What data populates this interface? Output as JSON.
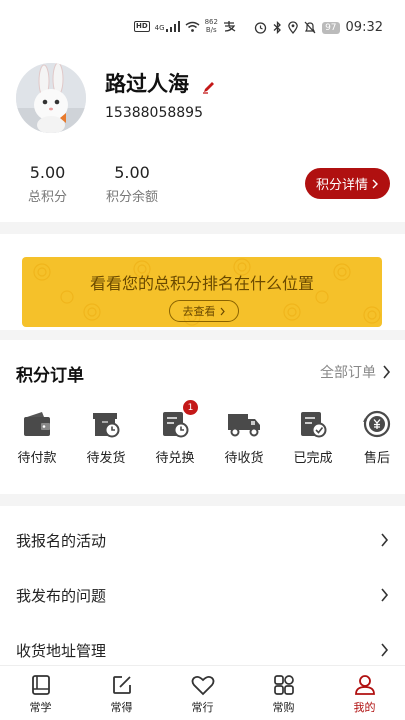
{
  "status_bar": {
    "hd": "HD",
    "net": "4G",
    "speed_value": "862",
    "speed_unit": "B/s",
    "battery": "97",
    "time": "09:32"
  },
  "profile": {
    "name": "路过人海",
    "phone": "15388058895"
  },
  "stats": [
    {
      "value": "5.00",
      "label": "总积分"
    },
    {
      "value": "5.00",
      "label": "积分余额"
    }
  ],
  "points_detail_button": "积分详情",
  "banner": {
    "title": "看看您的总积分排名在什么位置",
    "button": "去查看"
  },
  "orders": {
    "title": "积分订单",
    "all_link": "全部订单",
    "items": [
      {
        "label": "待付款",
        "icon": "wallet-icon"
      },
      {
        "label": "待发货",
        "icon": "box-clock-icon"
      },
      {
        "label": "待兑换",
        "icon": "clipboard-clock-icon",
        "badge": "1"
      },
      {
        "label": "待收货",
        "icon": "truck-icon"
      },
      {
        "label": "已完成",
        "icon": "clipboard-check-icon"
      },
      {
        "label": "售后",
        "icon": "yuan-refund-icon"
      }
    ]
  },
  "menu": [
    {
      "label": "我报名的活动"
    },
    {
      "label": "我发布的问题"
    },
    {
      "label": "收货地址管理"
    }
  ],
  "tabbar": [
    {
      "label": "常学",
      "icon": "book-icon"
    },
    {
      "label": "常得",
      "icon": "edit-square-icon"
    },
    {
      "label": "常行",
      "icon": "heart-icon"
    },
    {
      "label": "常购",
      "icon": "grid-icon"
    },
    {
      "label": "我的",
      "icon": "user-icon",
      "active": true
    }
  ],
  "colors": {
    "accent": "#b01010",
    "banner": "#f5c12a",
    "badge": "#c41818"
  }
}
